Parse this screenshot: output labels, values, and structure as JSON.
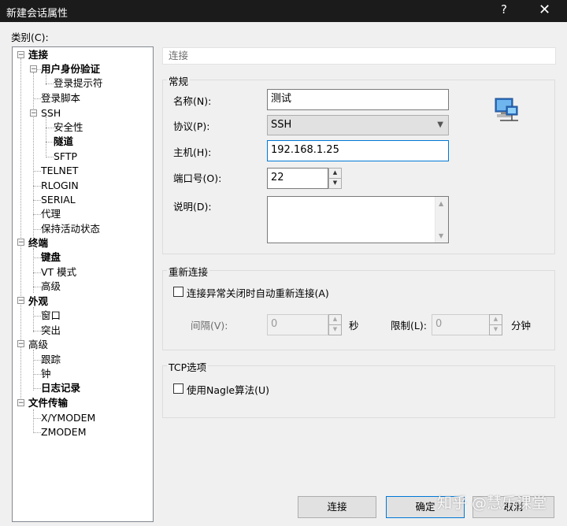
{
  "window": {
    "title": "新建会话属性",
    "help": "?",
    "close": "✕"
  },
  "category_label": "类别(C):",
  "tree": {
    "connection": "连接",
    "user_auth": "用户身份验证",
    "login_prompts": "登录提示符",
    "login_script": "登录脚本",
    "ssh": "SSH",
    "security": "安全性",
    "tunnel": "隧道",
    "sftp": "SFTP",
    "telnet": "TELNET",
    "rlogin": "RLOGIN",
    "serial": "SERIAL",
    "proxy": "代理",
    "keepalive": "保持活动状态",
    "terminal": "终端",
    "keyboard": "键盘",
    "vt_mode": "VT 模式",
    "advanced1": "高级",
    "appearance": "外观",
    "window": "窗口",
    "highlight": "突出",
    "advanced2": "高级",
    "trace": "跟踪",
    "bell": "钟",
    "logging": "日志记录",
    "file_transfer": "文件传输",
    "xymodem": "X/YMODEM",
    "zmodem": "ZMODEM"
  },
  "panel": {
    "header": "连接",
    "general": {
      "title": "常规",
      "name_label": "名称(N):",
      "name_value": "测试",
      "protocol_label": "协议(P):",
      "protocol_value": "SSH",
      "host_label": "主机(H):",
      "host_value": "192.168.1.25",
      "port_label": "端口号(O):",
      "port_value": "22",
      "desc_label": "说明(D):",
      "icon": "network-computer-icon"
    },
    "reconnect": {
      "title": "重新连接",
      "checkbox_label": "连接异常关闭时自动重新连接(A)",
      "interval_label": "间隔(V):",
      "interval_value": "0",
      "interval_unit": "秒",
      "limit_label": "限制(L):",
      "limit_value": "0",
      "limit_unit": "分钟"
    },
    "tcp": {
      "title": "TCP选项",
      "checkbox_label": "使用Nagle算法(U)"
    }
  },
  "buttons": {
    "connect": "连接",
    "ok": "确定",
    "cancel": "取消"
  },
  "watermark": "知乎 @慧乐课堂"
}
